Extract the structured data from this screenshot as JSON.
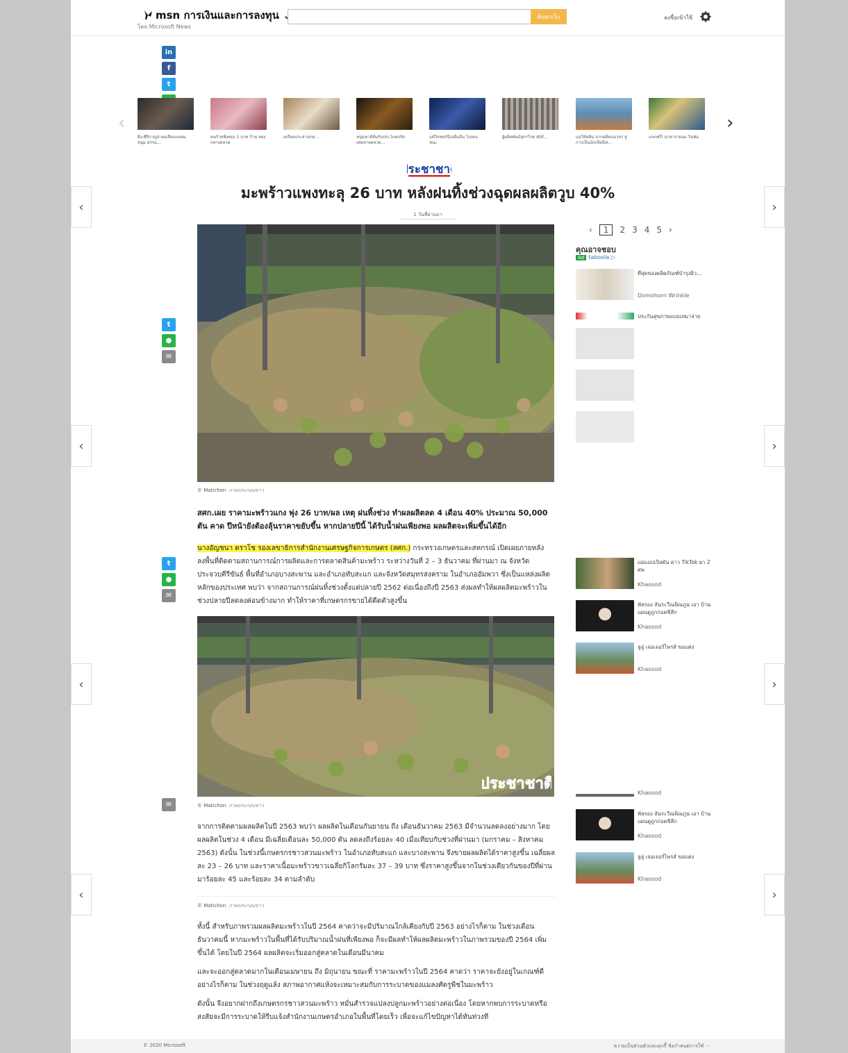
{
  "header": {
    "brand": "msn การเงินและการลงทุน ⌄",
    "byline": "โดย Microsoft News",
    "search_placeholder": "",
    "search_button": "ค้นหาเว็บ",
    "signin": "ลงชื่อเข้าใช้"
  },
  "carousel": [
    {
      "caption": "ติ๊ง-ศิริกาญจ์ ผมเสียบแหลม หนุ่ม สรรม..."
    },
    {
      "caption": "คนร้ายชิงทอง 1 บาท ร้าน ทองกลางตลาด"
    },
    {
      "caption": "เตรียมประสานกด..."
    },
    {
      "caption": "หนุ่มหาส์ทีมรับประโภคจรัด เศษขายดลวด..."
    },
    {
      "caption": "แค้วิธซอร์นีเลอีนอีน ไบเดน ชนะ"
    },
    {
      "caption": "ผู้ผลิตพันธ์สุกรโรค ASF..."
    },
    {
      "caption": "แม่ให้คลิ่น จากอดีตแม่วจร สู่การเป็นนักเขียนีฟ..."
    },
    {
      "caption": "แจกฟรี! อาหาร-ขนม วันฟ่อ"
    }
  ],
  "article": {
    "title": "มะพร้าวแพงทะลุ 26 บาท หลังฝนทิ้งช่วงฉุดผลผลิตวูบ 40%",
    "timestamp": "1 วันที่ผ่านมา",
    "credit": "© Matichon",
    "credit_src": "ภาพประกอบข่าว",
    "lead": "สศก.เผย ราคามะพร้าวแกง พุ่ง 26 บาท/ผล เหตุ ฝนทิ้งช่วง ทำผลผลิตลด 4 เดือน 40% ประมาณ 50,000 ตัน คาด ปีหน้ายังต้องลุ้นราคาขยับขึ้น หากปลายปีนี้ ได้รับน้ำฝนเพียงพอ ผลผลิตจะเพิ่มขึ้นได้อีก",
    "para1_highlight": "นางอัญชนา ตราโช รองเลขาธิการสำนักงานเศรษฐกิจการเกษตร (สศก.)",
    "para1": " กระทรวงเกษตรและสหกรณ์ เปิดเผยภายหลังลงพื้นที่ติดตามสถานการณ์การผลิตและการตลาดสินค้ามะพร้าว ระหว่างวันที่ 2 – 3 ธันวาคม ที่ผ่านมา ณ จังหวัดประจวบคีรีขันธ์ พื้นที่อำเภอบางสะพาน และอำเภอทับสะแก และจังหวัดสมุทรสงคราม ในอำเภออัมพวา ซึ่งเป็นแหล่งผลิตหลักของประเทศ พบว่า จากสถานการณ์ฝนทิ้งช่วงตั้งแต่ปลายปี 2562 ต่อเนื่องถึงปี 2563 ส่งผลทำให้ผลผลิตมะพร้าวในช่วงปลายปีลดลงค่อนข้างมาก ทำให้ราคาที่เกษตรกรขายได้ดีดตัวสูงขึ้น",
    "para2": "จากการติดตามผลผลิตในปี 2563 พบว่า ผลผลิตในเดือนกันยายน ถึง เดือนธันวาคม 2563 มีจำนวนลดลงอย่างมาก โดยผลผลิตในช่วง 4 เดือน มีเฉลี่ยเดือนละ 50,000 ตัน ลดลงถึงร้อยละ 40 เมื่อเทียบกับช่วงที่ผ่านมา (มกราคม – สิงหาคม 2563) ดังนั้น ในช่วงนี้เกษตรกรชาวสวนมะพร้าว ในอำเภอทับสะแก และบางสะพาน จึงขายผลผลิตได้ราคาสูงขึ้น เฉลี่ยผลละ 23 – 26 บาท และราคาเนื้อมะพร้าวขาวเฉลี่ยกิโลกรัมละ 37 – 39 บาท ซึ่งราคาสูงขึ้นจากในช่วงเดียวกันของปีที่ผ่านมาร้อยละ 45 และร้อยละ 34 ตามลำดับ",
    "para3": "ทั้งนี้ สำหรับภาพรวมผลผลิตมะพร้าวในปี 2564 คาดว่าจะมีปริมาณใกล้เคียงกับปี 2563 อย่างไรก็ตาม ในช่วงเดือนธันวาคมนี้ หากมะพร้าวในพื้นที่ได้รับปริมาณน้ำฝนที่เพียงพอ ก็จะมีผลทำให้ผลผลิตมะพร้าวในภาพรวมของปี 2564 เพิ่มขึ้นได้ โดยในปี 2564 ผลผลิตจะเริ่มออกสู่ตลาดในเดือนมีนาคม",
    "para4": "และจะออกสู่ตลาดมากในเดือนเมษายน ถึง มิถุนายน ขณะที่ ราคามะพร้าวในปี 2564 คาดว่า ราคาจะยังอยู่ในเกณฑ์ดี อย่างไรก็ตาม ในช่วงฤดูแล้ง สภาพอากาศแห้งจะเหมาะสมกับการระบาดของแมลงศัตรูพืชในมะพร้าว",
    "para5": "ดังนั้น จึงอยากฝากถึงเกษตรกรชาวสวนมะพร้าว หมั่นสำรวจแปลงปลูกมะพร้าวอย่างต่อเนื่อง โดยหากพบการระบาดหรือสงสัยจะมีการระบาดให้รีบแจ้งสำนักงานเกษตรอำเภอในพื้นที่โดยเร็ว เพื่อจะแก้ไขปัญหาได้ทันท่วงที"
  },
  "publisher": "ประชาชาติ",
  "rail": {
    "pages": [
      "1",
      "2",
      "3",
      "4",
      "5"
    ],
    "rec_title": "คุณอาจชอบ",
    "ad_label": "Ad",
    "taboola": "taboola ▷",
    "items_top": [
      {
        "title": "ที่สุดของผลิตภัณฑ์บำรุงผิว...",
        "src": "Domohorn Wrinkle"
      },
      {
        "title": "ประกันสุขภาพแบบเหมาจ่าย",
        "src": ""
      }
    ],
    "items_mid": [
      {
        "title": "แม่แอปเปิลผัน ดาว TikTok ผา 2 ศพ",
        "src": "Khaosod"
      },
      {
        "title": "พัลรอง ลันระวีณพิณภูน เอา บ้านแผนดูถูกก่อคชิลีก",
        "src": "Khaosod"
      },
      {
        "title": "ลูลู่ เจอเจอร์ไพรส์ ขอแต่ง",
        "src": "Khaosod"
      }
    ],
    "items_bottom": [
      {
        "title": "พัลรอง ลันระวีณพิณภูน เอา บ้านแผนดูถูกก่อคชิลีก",
        "src": "Khaosod"
      },
      {
        "title": "ลูลู่ เจอเจอร์ไพรส์ ขอแต่ง",
        "src": "Khaosod"
      }
    ],
    "orphan_src": "Khaosod"
  },
  "footer": {
    "copyright": "© 2020 Microsoft",
    "links": "ความเป็นส่วนตัวและคุกกี้   ข้อกำหนดการใช้   ···"
  }
}
